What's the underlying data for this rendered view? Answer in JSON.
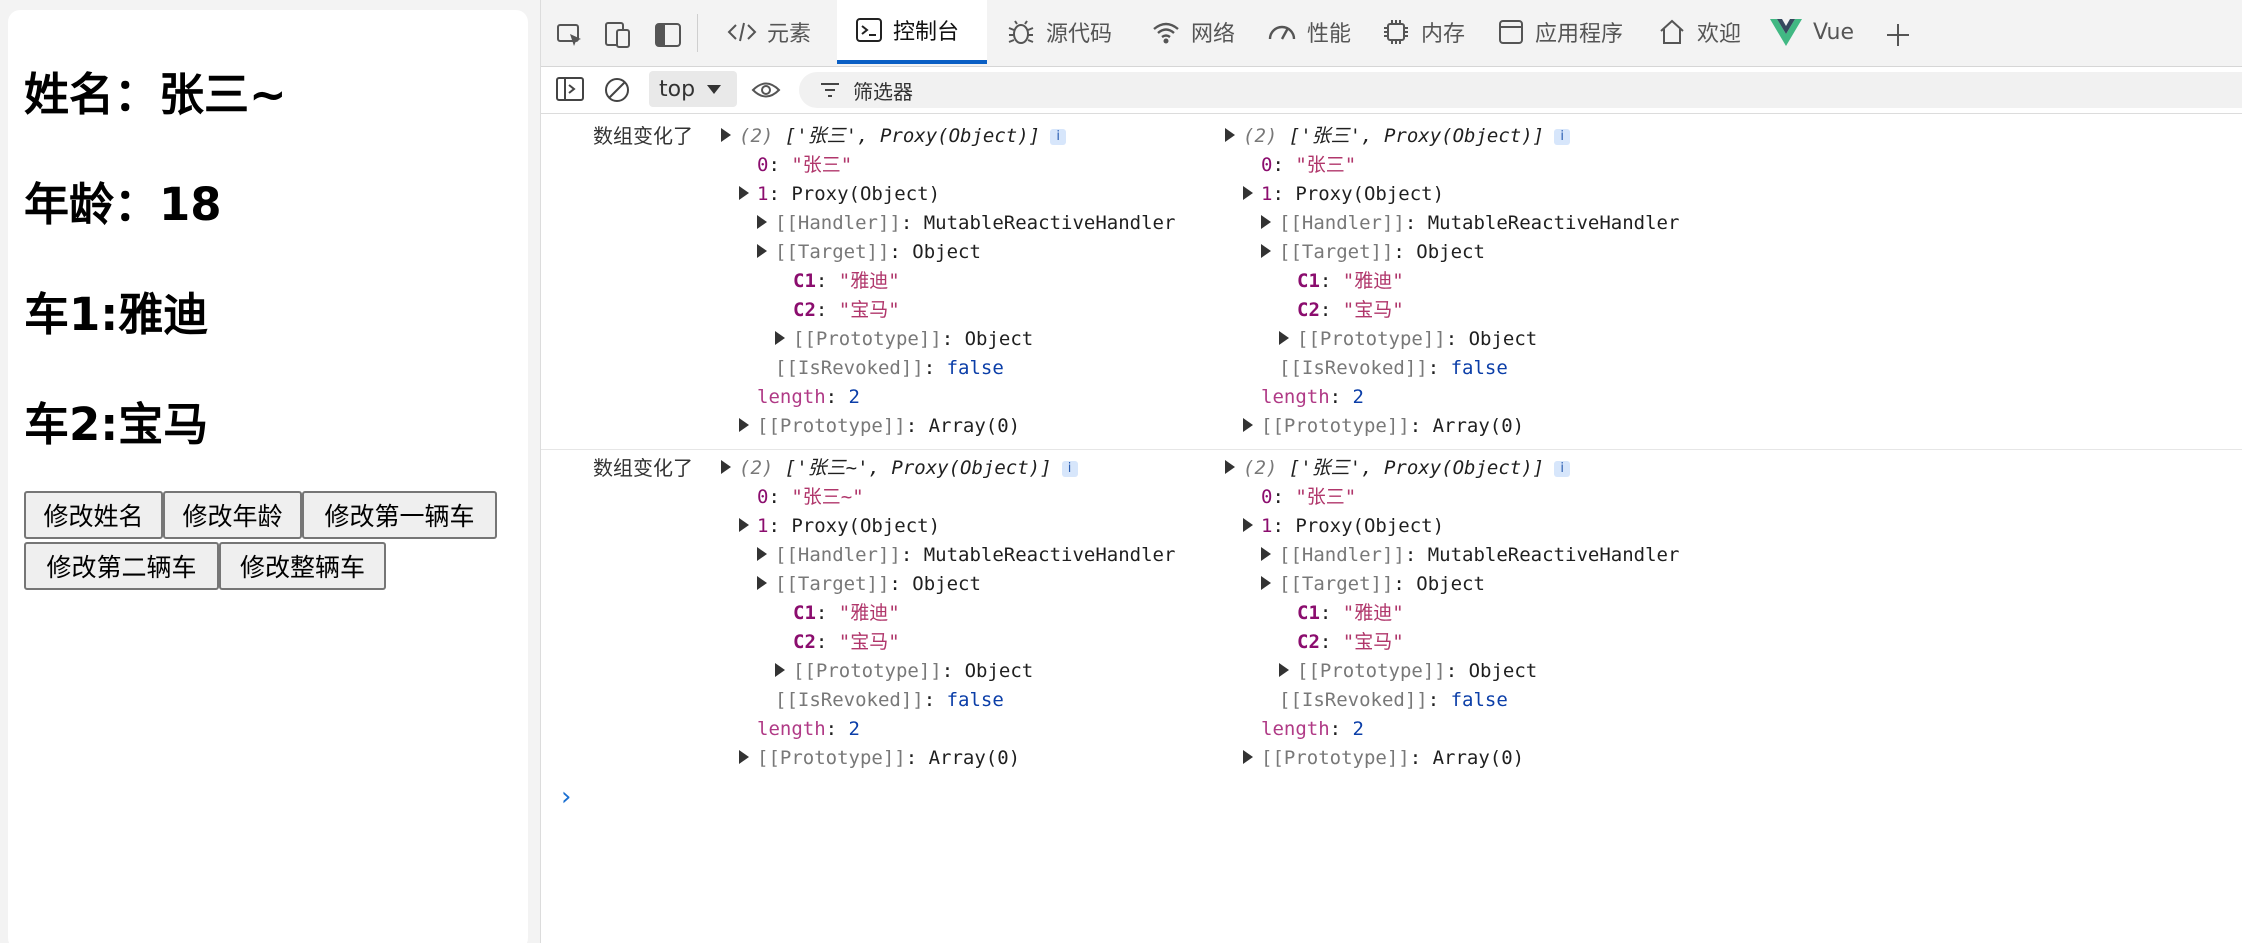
{
  "page": {
    "name_label": "姓名：张三~",
    "age_label": "年龄：18",
    "car1_label": "车1:雅迪",
    "car2_label": "车2:宝马",
    "buttons": {
      "change_name": "修改姓名",
      "change_age": "修改年龄",
      "change_car1": "修改第一辆车",
      "change_car2": "修改第二辆车",
      "change_all_cars": "修改整辆车"
    }
  },
  "devtools": {
    "tabs": [
      {
        "label": "元素",
        "icon": "code-icon"
      },
      {
        "label": "控制台",
        "icon": "console-icon"
      },
      {
        "label": "源代码",
        "icon": "bug-icon"
      },
      {
        "label": "网络",
        "icon": "wifi-icon"
      },
      {
        "label": "性能",
        "icon": "gauge-icon"
      },
      {
        "label": "内存",
        "icon": "chip-icon"
      },
      {
        "label": "应用程序",
        "icon": "app-icon"
      },
      {
        "label": "欢迎",
        "icon": "home-icon"
      },
      {
        "label": "Vue",
        "icon": "vue-logo-icon"
      }
    ],
    "active_tab": "控制台",
    "context": "top",
    "filter_placeholder": "筛选器",
    "colors": {
      "accent": "#0a5fc4",
      "vue_green": "#41b883",
      "vue_dark": "#35495e"
    }
  },
  "console": {
    "messages": [
      {
        "text": "数组变化了",
        "arrays": [
          {
            "length_prefix": "(2)",
            "summary": "['张三', Proxy(Object)]",
            "item0_key": "0",
            "item0_value": "\"张三\"",
            "item1_key": "1",
            "item1_value": "Proxy(Object)",
            "handler_key": "[[Handler]]",
            "handler_value": "MutableReactiveHandler",
            "target_key": "[[Target]]",
            "target_value": "Object",
            "c1_key": "C1",
            "c1_value": "\"雅迪\"",
            "c2_key": "C2",
            "c2_value": "\"宝马\"",
            "inner_proto_key": "[[Prototype]]",
            "inner_proto_value": "Object",
            "revoked_key": "[[IsRevoked]]",
            "revoked_value": "false",
            "length_key": "length",
            "length_value": "2",
            "proto_key": "[[Prototype]]",
            "proto_value": "Array(0)"
          },
          {
            "length_prefix": "(2)",
            "summary": "['张三', Proxy(Object)]",
            "item0_key": "0",
            "item0_value": "\"张三\"",
            "item1_key": "1",
            "item1_value": "Proxy(Object)",
            "handler_key": "[[Handler]]",
            "handler_value": "MutableReactiveHandler",
            "target_key": "[[Target]]",
            "target_value": "Object",
            "c1_key": "C1",
            "c1_value": "\"雅迪\"",
            "c2_key": "C2",
            "c2_value": "\"宝马\"",
            "inner_proto_key": "[[Prototype]]",
            "inner_proto_value": "Object",
            "revoked_key": "[[IsRevoked]]",
            "revoked_value": "false",
            "length_key": "length",
            "length_value": "2",
            "proto_key": "[[Prototype]]",
            "proto_value": "Array(0)"
          }
        ]
      },
      {
        "text": "数组变化了",
        "arrays": [
          {
            "length_prefix": "(2)",
            "summary": "['张三~', Proxy(Object)]",
            "item0_key": "0",
            "item0_value": "\"张三~\"",
            "item1_key": "1",
            "item1_value": "Proxy(Object)",
            "handler_key": "[[Handler]]",
            "handler_value": "MutableReactiveHandler",
            "target_key": "[[Target]]",
            "target_value": "Object",
            "c1_key": "C1",
            "c1_value": "\"雅迪\"",
            "c2_key": "C2",
            "c2_value": "\"宝马\"",
            "inner_proto_key": "[[Prototype]]",
            "inner_proto_value": "Object",
            "revoked_key": "[[IsRevoked]]",
            "revoked_value": "false",
            "length_key": "length",
            "length_value": "2",
            "proto_key": "[[Prototype]]",
            "proto_value": "Array(0)"
          },
          {
            "length_prefix": "(2)",
            "summary": "['张三', Proxy(Object)]",
            "item0_key": "0",
            "item0_value": "\"张三\"",
            "item1_key": "1",
            "item1_value": "Proxy(Object)",
            "handler_key": "[[Handler]]",
            "handler_value": "MutableReactiveHandler",
            "target_key": "[[Target]]",
            "target_value": "Object",
            "c1_key": "C1",
            "c1_value": "\"雅迪\"",
            "c2_key": "C2",
            "c2_value": "\"宝马\"",
            "inner_proto_key": "[[Prototype]]",
            "inner_proto_value": "Object",
            "revoked_key": "[[IsRevoked]]",
            "revoked_value": "false",
            "length_key": "length",
            "length_value": "2",
            "proto_key": "[[Prototype]]",
            "proto_value": "Array(0)"
          }
        ]
      }
    ]
  }
}
